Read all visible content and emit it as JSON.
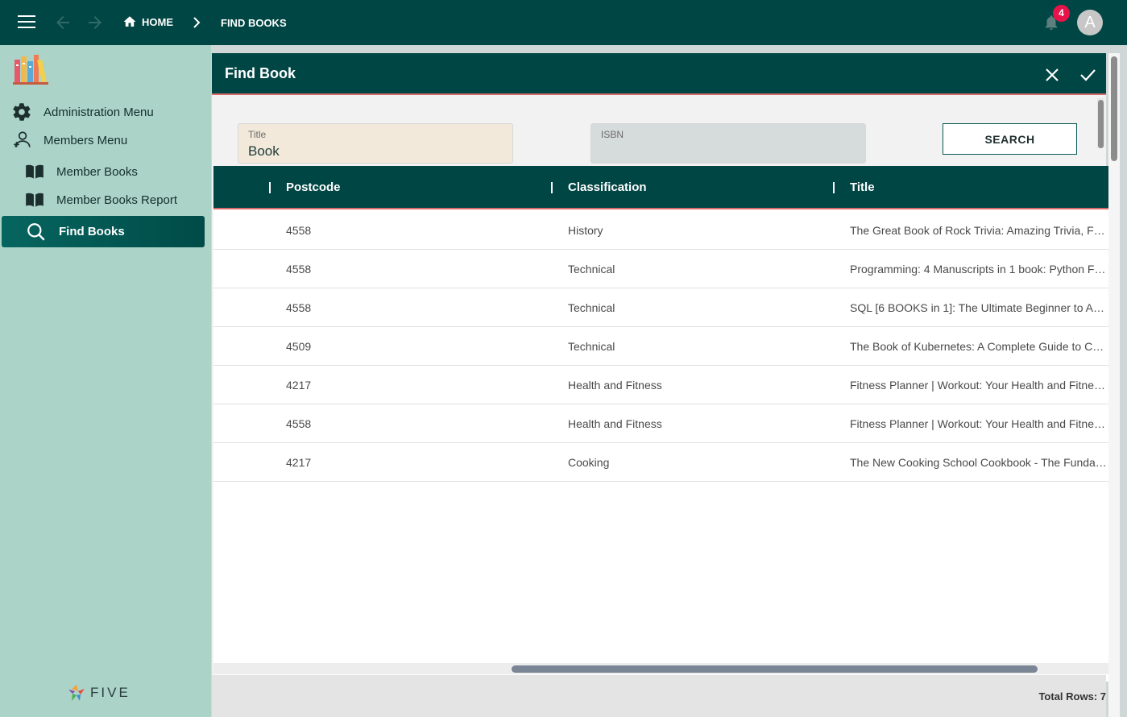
{
  "topbar": {
    "home_label": "HOME",
    "breadcrumb_current": "FIND BOOKS",
    "notification_count": "4",
    "avatar_initial": "A"
  },
  "sidebar": {
    "items": [
      {
        "label": "Administration Menu",
        "icon": "gear-icon"
      },
      {
        "label": "Members Menu",
        "icon": "user-add-icon"
      },
      {
        "label": "Member Books",
        "icon": "open-book-icon"
      },
      {
        "label": "Member Books Report",
        "icon": "open-book-icon"
      },
      {
        "label": "Find Books",
        "icon": "search-icon",
        "active": true
      }
    ],
    "brand": "FIVE"
  },
  "panel": {
    "title": "Find Book",
    "title_field": {
      "label": "Title",
      "value": "Book"
    },
    "isbn_field": {
      "label": "ISBN",
      "value": ""
    },
    "search_label": "SEARCH"
  },
  "grid": {
    "columns": [
      "Postcode",
      "Classification",
      "Title"
    ],
    "rows": [
      [
        "4558",
        "History",
        "The Great Book of Rock Trivia: Amazing Trivia, F…"
      ],
      [
        "4558",
        "Technical",
        "Programming: 4 Manuscripts in 1 book: Python F…"
      ],
      [
        "4558",
        "Technical",
        "SQL [6 BOOKS in 1]: The Ultimate Beginner to Ad…"
      ],
      [
        "4509",
        "Technical",
        "The Book of Kubernetes: A Complete Guide to C…"
      ],
      [
        "4217",
        "Health and Fitness",
        "Fitness Planner | Workout: Your Health and Fitne…"
      ],
      [
        "4558",
        "Health and Fitness",
        "Fitness Planner | Workout: Your Health and Fitne…"
      ],
      [
        "4217",
        "Cooking",
        "The New Cooking School Cookbook - The Funda…"
      ]
    ],
    "total_rows": "Total Rows: 7"
  },
  "colors": {
    "primary": "#004644",
    "sidebar": "#acd3c7",
    "accent_line": "#d96b6b",
    "badge": "#e8134a"
  }
}
